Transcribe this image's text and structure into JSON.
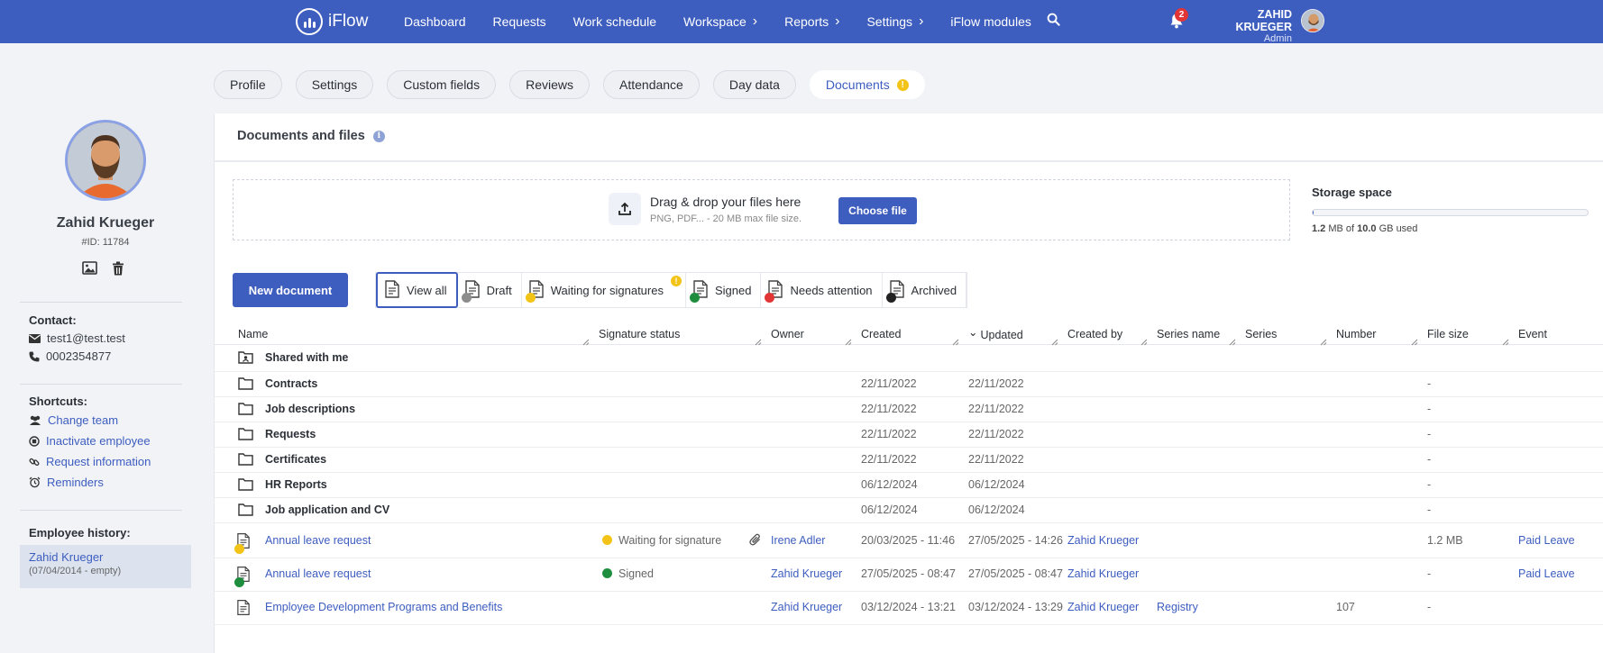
{
  "app": {
    "logo_text": "iFlow"
  },
  "nav": {
    "items": [
      {
        "label": "Dashboard"
      },
      {
        "label": "Requests"
      },
      {
        "label": "Work schedule"
      },
      {
        "label": "Workspace",
        "has_menu": true
      },
      {
        "label": "Reports",
        "has_menu": true
      },
      {
        "label": "Settings",
        "has_menu": true
      },
      {
        "label": "iFlow modules"
      }
    ],
    "notification_count": "2",
    "user_name": "ZAHID KRUEGER",
    "user_role": "Admin"
  },
  "employee": {
    "name": "Zahid Krueger",
    "id_label": "#ID: 11784",
    "contact_heading": "Contact:",
    "email": "test1@test.test",
    "phone": "0002354877",
    "shortcuts_heading": "Shortcuts:",
    "shortcuts": [
      "Change team",
      "Inactivate employee",
      "Request information",
      "Reminders"
    ],
    "history_heading": "Employee history:",
    "history_name": "Zahid Krueger",
    "history_dates": "(07/04/2014 - empty)"
  },
  "tabs": [
    {
      "label": "Profile"
    },
    {
      "label": "Settings"
    },
    {
      "label": "Custom fields"
    },
    {
      "label": "Reviews"
    },
    {
      "label": "Attendance"
    },
    {
      "label": "Day data"
    },
    {
      "label": "Documents",
      "active": true,
      "warning": "!"
    }
  ],
  "documents": {
    "title": "Documents and files",
    "info_icon": "i",
    "drop_title": "Drag & drop your files here",
    "drop_sub": "PNG, PDF... - 20 MB max file size.",
    "choose_label": "Choose file",
    "storage_title": "Storage space",
    "storage_used": "1.2",
    "storage_used_unit": " MB of ",
    "storage_total": "10.0",
    "storage_suffix": " GB used",
    "storage_fraction": 0.00012,
    "new_document_label": "New document",
    "filters": [
      {
        "label": "View all",
        "active": true
      },
      {
        "label": "Draft",
        "badge_color": "#8c8c8c"
      },
      {
        "label": "Waiting for signatures",
        "badge_color": "#f3c417",
        "warning": "!"
      },
      {
        "label": "Signed",
        "badge_color": "#1e8e3e"
      },
      {
        "label": "Needs attention",
        "badge_color": "#e23636"
      },
      {
        "label": "Archived",
        "badge_color": "#222222"
      }
    ],
    "columns": [
      "Name",
      "Signature status",
      "Owner",
      "Created",
      "Updated",
      "Created by",
      "Series name",
      "Series",
      "Number",
      "File size",
      "Event"
    ],
    "folders": [
      {
        "name": "Shared with me",
        "created": "",
        "updated": "",
        "size": "",
        "shared": true
      },
      {
        "name": "Contracts",
        "created": "22/11/2022",
        "updated": "22/11/2022",
        "size": "-"
      },
      {
        "name": "Job descriptions",
        "created": "22/11/2022",
        "updated": "22/11/2022",
        "size": "-"
      },
      {
        "name": "Requests",
        "created": "22/11/2022",
        "updated": "22/11/2022",
        "size": "-"
      },
      {
        "name": "Certificates",
        "created": "22/11/2022",
        "updated": "22/11/2022",
        "size": "-"
      },
      {
        "name": "HR Reports",
        "created": "06/12/2024",
        "updated": "06/12/2024",
        "size": "-"
      },
      {
        "name": "Job application and CV",
        "created": "06/12/2024",
        "updated": "06/12/2024",
        "size": "-"
      }
    ],
    "files": [
      {
        "name": "Annual leave request",
        "status": "Waiting for signature",
        "status_color": "#f3c417",
        "attachment": true,
        "owner": "Irene Adler",
        "created": "20/03/2025 - 11:46",
        "updated": "27/05/2025 - 14:26",
        "created_by": "Zahid Krueger",
        "series_name": "",
        "number": "",
        "size": "1.2 MB",
        "event": "Paid Leave"
      },
      {
        "name": "Annual leave request",
        "status": "Signed",
        "status_color": "#1e8e3e",
        "attachment": false,
        "owner": "Zahid Krueger",
        "created": "27/05/2025 - 08:47",
        "updated": "27/05/2025 - 08:47",
        "created_by": "Zahid Krueger",
        "series_name": "",
        "number": "",
        "size": "-",
        "event": "Paid Leave"
      },
      {
        "name": "Employee Development Programs and Benefits",
        "status": "",
        "status_color": "",
        "attachment": false,
        "owner": "Zahid Krueger",
        "created": "03/12/2024 - 13:21",
        "updated": "03/12/2024 - 13:29",
        "created_by": "Zahid Krueger",
        "series_name": "Registry",
        "number": "107",
        "size": "-",
        "event": ""
      }
    ]
  }
}
